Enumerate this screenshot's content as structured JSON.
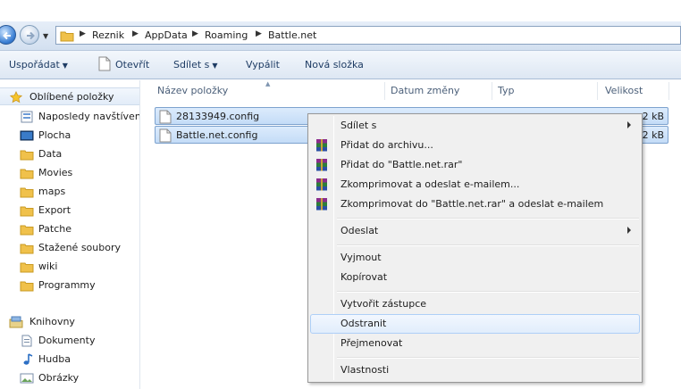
{
  "address_bar": {
    "breadcrumbs": [
      "Reznik",
      "AppData",
      "Roaming",
      "Battle.net"
    ]
  },
  "toolbar": {
    "organize": "Uspořádat",
    "open": "Otevřít",
    "share": "Sdílet s",
    "burn": "Vypálit",
    "new_folder": "Nová složka"
  },
  "sidebar": {
    "favorites_header": "Oblíbené položky",
    "favorites": [
      "Naposledy navštívené",
      "Plocha",
      "Data",
      "Movies",
      "maps",
      "Export",
      "Patche",
      "Stažené soubory",
      "wiki",
      "Programmy"
    ],
    "libraries_header": "Knihovny",
    "libraries": [
      "Dokumenty",
      "Hudba",
      "Obrázky"
    ]
  },
  "columns": {
    "name": "Název položky",
    "date": "Datum změny",
    "type": "Typ",
    "size": "Velikost"
  },
  "files": [
    {
      "name": "28133949.config",
      "size": "2 kB"
    },
    {
      "name": "Battle.net.config",
      "size": "2 kB"
    }
  ],
  "context_menu": {
    "share": "Sdílet s",
    "add_archive": "Přidat do archivu...",
    "add_rar": "Přidat do \"Battle.net.rar\"",
    "compress_email": "Zkomprimovat a odeslat e-mailem...",
    "compress_rar_email": "Zkomprimovat do \"Battle.net.rar\" a odeslat e-mailem",
    "send_to": "Odeslat",
    "cut": "Vyjmout",
    "copy": "Kopírovat",
    "create_shortcut": "Vytvořit zástupce",
    "delete": "Odstranit",
    "rename": "Přejmenovat",
    "properties": "Vlastnosti"
  },
  "icons": {
    "back": "back-arrow-icon",
    "forward": "forward-arrow-icon",
    "folder": "folder-icon",
    "star": "star-icon",
    "document": "document-icon",
    "winrar": "winrar-icon"
  },
  "colors": {
    "selection": "#cde3fb",
    "menu_highlight": "#e1edfc",
    "toolbar_text": "#1e3c64"
  }
}
